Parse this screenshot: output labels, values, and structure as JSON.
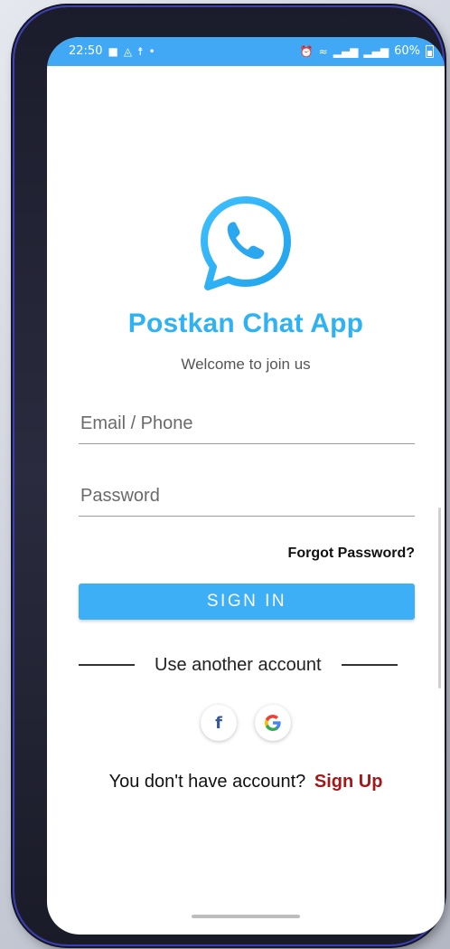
{
  "status_bar": {
    "time": "22:50",
    "left_icons": [
      "video-icon",
      "sync-icon",
      "accessibility-icon",
      "dot-icon"
    ],
    "right_icons": [
      "alarm-icon",
      "wifi-icon",
      "signal-icon",
      "signal-icon"
    ],
    "battery": "60%"
  },
  "app": {
    "name": "Postkan Chat App",
    "tagline": "Welcome to join us",
    "logo_icon": "chat-phone-icon",
    "accent_color": "#2fb2f1"
  },
  "form": {
    "email_placeholder": "Email / Phone",
    "password_placeholder": "Password",
    "forgot_label": "Forgot Password?",
    "signin_label": "SIGN IN"
  },
  "alt_login": {
    "divider_text": "Use another account",
    "providers": [
      "facebook-icon",
      "google-icon"
    ],
    "facebook_glyph": "f"
  },
  "signup": {
    "prompt": "You don't have account?",
    "link": "Sign Up",
    "link_color": "#a11919"
  }
}
